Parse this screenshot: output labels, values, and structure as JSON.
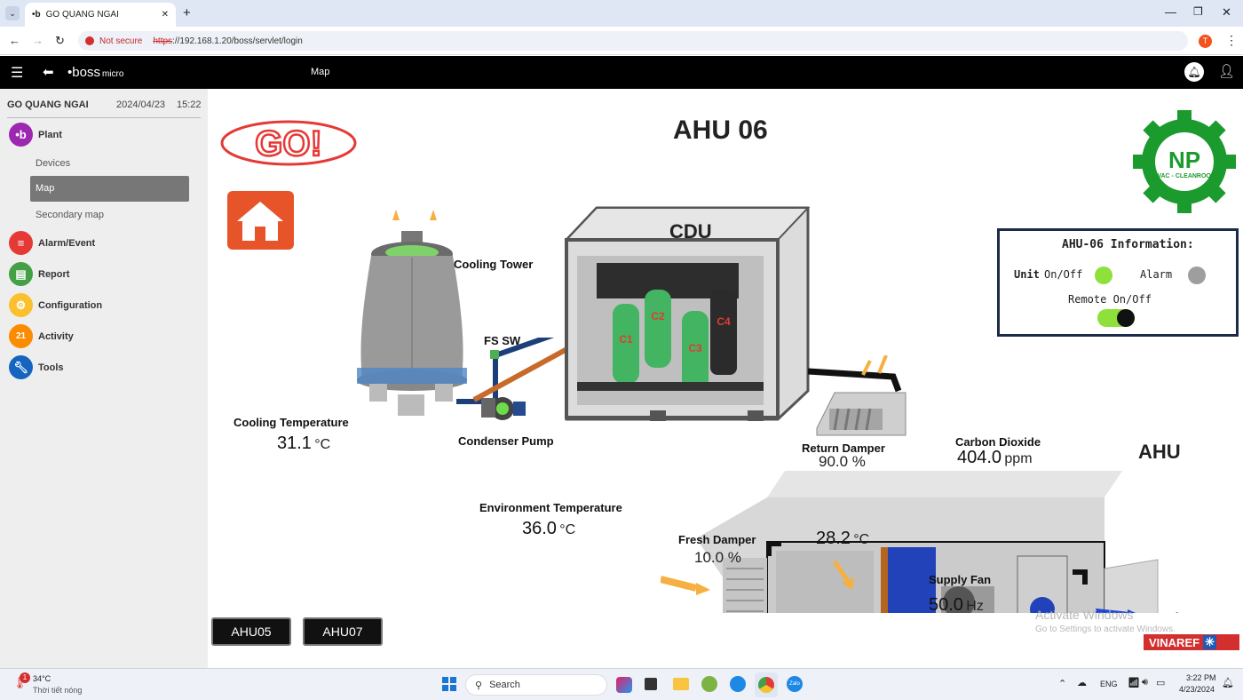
{
  "browser": {
    "tab_title": "GO QUANG NGAI",
    "not_secure": "Not secure",
    "url_scheme": "https",
    "url_rest": "://192.168.1.20/boss/servlet/login",
    "profile_initial": "T"
  },
  "header": {
    "brand": "boss",
    "brand_suffix": "micro",
    "page_title": "Map"
  },
  "sidebar": {
    "site": "GO QUANG NGAI",
    "date": "2024/04/23",
    "time": "15:22",
    "plant": "Plant",
    "devices": "Devices",
    "map": "Map",
    "secondary_map": "Secondary map",
    "alarm": "Alarm/Event",
    "report": "Report",
    "configuration": "Configuration",
    "activity": "Activity",
    "tools": "Tools",
    "colors": {
      "plant": "#9c27b0",
      "alarm": "#e53935",
      "report": "#43a047",
      "configuration": "#fbc02d",
      "activity": "#fb8c00",
      "tools": "#1565c0"
    }
  },
  "scada": {
    "title": "AHU 06",
    "logo_text": "GO!",
    "np_logo": "NP",
    "np_sub": "HVAC - CLEANROOM",
    "cdu": "CDU",
    "compressors": [
      "C1",
      "C2",
      "C3",
      "C4"
    ],
    "cooling_tower": "Cooling Tower",
    "fs_sw": "FS SW",
    "condenser_pump": "Condenser Pump",
    "cooling_temp_label": "Cooling Temperature",
    "cooling_temp_value": "31.1",
    "env_temp_label": "Environment Temperature",
    "env_temp_value": "36.0",
    "temp_unit": "°C",
    "return_damper_label": "Return Damper",
    "return_damper_value": "90.0 %",
    "co2_label": "Carbon Dioxide",
    "co2_value": "404.0",
    "co2_unit": "ppm",
    "ahu_label": "AHU",
    "fresh_damper_label": "Fresh Damper",
    "fresh_damper_value": "10.0 %",
    "supply_temp_value": "28.2",
    "supply_fan_label": "Supply Fan",
    "supply_fan_value": "50.0",
    "supply_fan_unit": "Hz",
    "btn_prev": "AHU05",
    "btn_next": "AHU07",
    "vinaref": "VINAREF",
    "watermark1": "Activate Windows",
    "watermark2": "Go to Settings to activate Windows."
  },
  "info_panel": {
    "title": "AHU-06 Information:",
    "unit_label": "Unit",
    "onoff_label": "On/Off",
    "alarm_label": "Alarm",
    "remote_label": "Remote On/Off",
    "unit_on": true,
    "alarm_on": false,
    "remote_on": true,
    "on_color": "#8ee03b",
    "off_color": "#9e9e9e"
  },
  "taskbar": {
    "weather_temp": "34°C",
    "weather_desc": "Thời tiết nóng",
    "search": "Search",
    "lang": "ENG",
    "time": "3:22 PM",
    "date": "4/23/2024",
    "weather_badge": "1"
  }
}
